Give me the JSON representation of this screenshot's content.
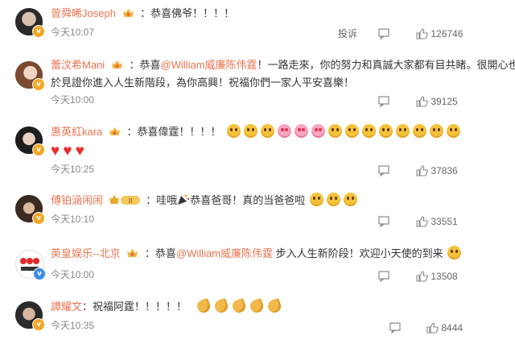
{
  "comments": [
    {
      "username": "曾舜晞Joseph",
      "text": "：恭喜佛爷！！！！",
      "time": "今天10:07",
      "report_label": "投诉",
      "likes": "126746",
      "verified_color": "#f5a623",
      "avatar_icon": "person-avatar-icon"
    },
    {
      "username": "蕾汶希Mani",
      "text_prefix": "：恭喜",
      "mention": "@William威廉陈伟霆",
      "text_suffix": "！一路走來，你的努力和真誠大家都有目共睹。很開心也終",
      "text_line2": "於見證你進入人生新階段，為你高興！祝福你們一家人平安喜樂！",
      "time": "今天10:00",
      "likes": "39125",
      "verified_color": "#f5a623"
    },
    {
      "username": "惠英紅kara",
      "text": "：恭喜偉霆！！！！",
      "emoji_row": [
        "smile-emoji",
        "smile-emoji",
        "smile-emoji",
        "love-emoji",
        "love-emoji",
        "love-emoji",
        "smile-emoji",
        "smile-emoji",
        "smile-emoji",
        "smile-emoji",
        "smile-emoji",
        "smile-emoji",
        "smile-emoji",
        "smile-emoji"
      ],
      "hearts": [
        "heart-icon",
        "heart-icon",
        "heart-icon"
      ],
      "time": "今天10:25",
      "likes": "37836",
      "verified_color": "#f5a623"
    },
    {
      "username": "傅铂涵闹闹",
      "text_prefix": "：哇哦",
      "text_suffix": "恭喜爸哥！真的当爸爸啦",
      "time": "今天10:10",
      "likes": "33551",
      "verified_color": "#f5a623"
    },
    {
      "username": "英皇娱乐--北京",
      "text_prefix": "：恭喜",
      "mention": "@William威廉陈伟霆",
      "text_suffix": " 步入人生新阶段！欢迎小天使的到来",
      "time": "今天10:00",
      "likes": "13508",
      "verified_color": "#3b8ee8"
    },
    {
      "username": "譚耀文",
      "text": "：祝福阿霆！！！！！",
      "time": "今天10:35",
      "likes": "8444",
      "verified_color": "#f5a623"
    }
  ],
  "colors": {
    "username": "#eb7350",
    "text": "#333333",
    "meta": "#888888"
  }
}
